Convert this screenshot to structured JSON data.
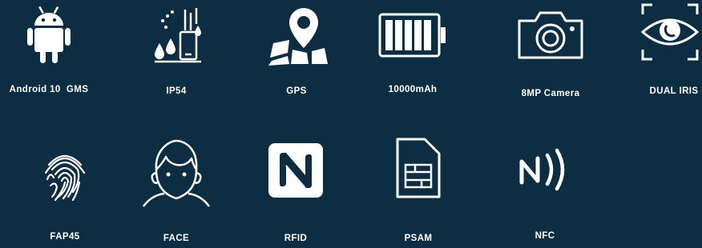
{
  "features": [
    {
      "label": "Android 10  GMS",
      "icon": "android-icon"
    },
    {
      "label": "IP54",
      "icon": "water-resistance-icon"
    },
    {
      "label": "GPS",
      "icon": "map-pin-icon"
    },
    {
      "label": "10000mAh",
      "icon": "battery-icon"
    },
    {
      "label": "8MP Camera",
      "icon": "camera-icon"
    },
    {
      "label": "DUAL IRIS",
      "icon": "iris-scan-icon"
    },
    {
      "label": "FAP45",
      "icon": "fingerprint-icon"
    },
    {
      "label": "FACE",
      "icon": "face-icon"
    },
    {
      "label": "RFID",
      "icon": "rfid-n-icon"
    },
    {
      "label": "PSAM",
      "icon": "sim-card-icon"
    },
    {
      "label": "NFC",
      "icon": "nfc-icon"
    }
  ],
  "colors": {
    "background": "#0d2d42",
    "foreground": "#ffffff"
  }
}
